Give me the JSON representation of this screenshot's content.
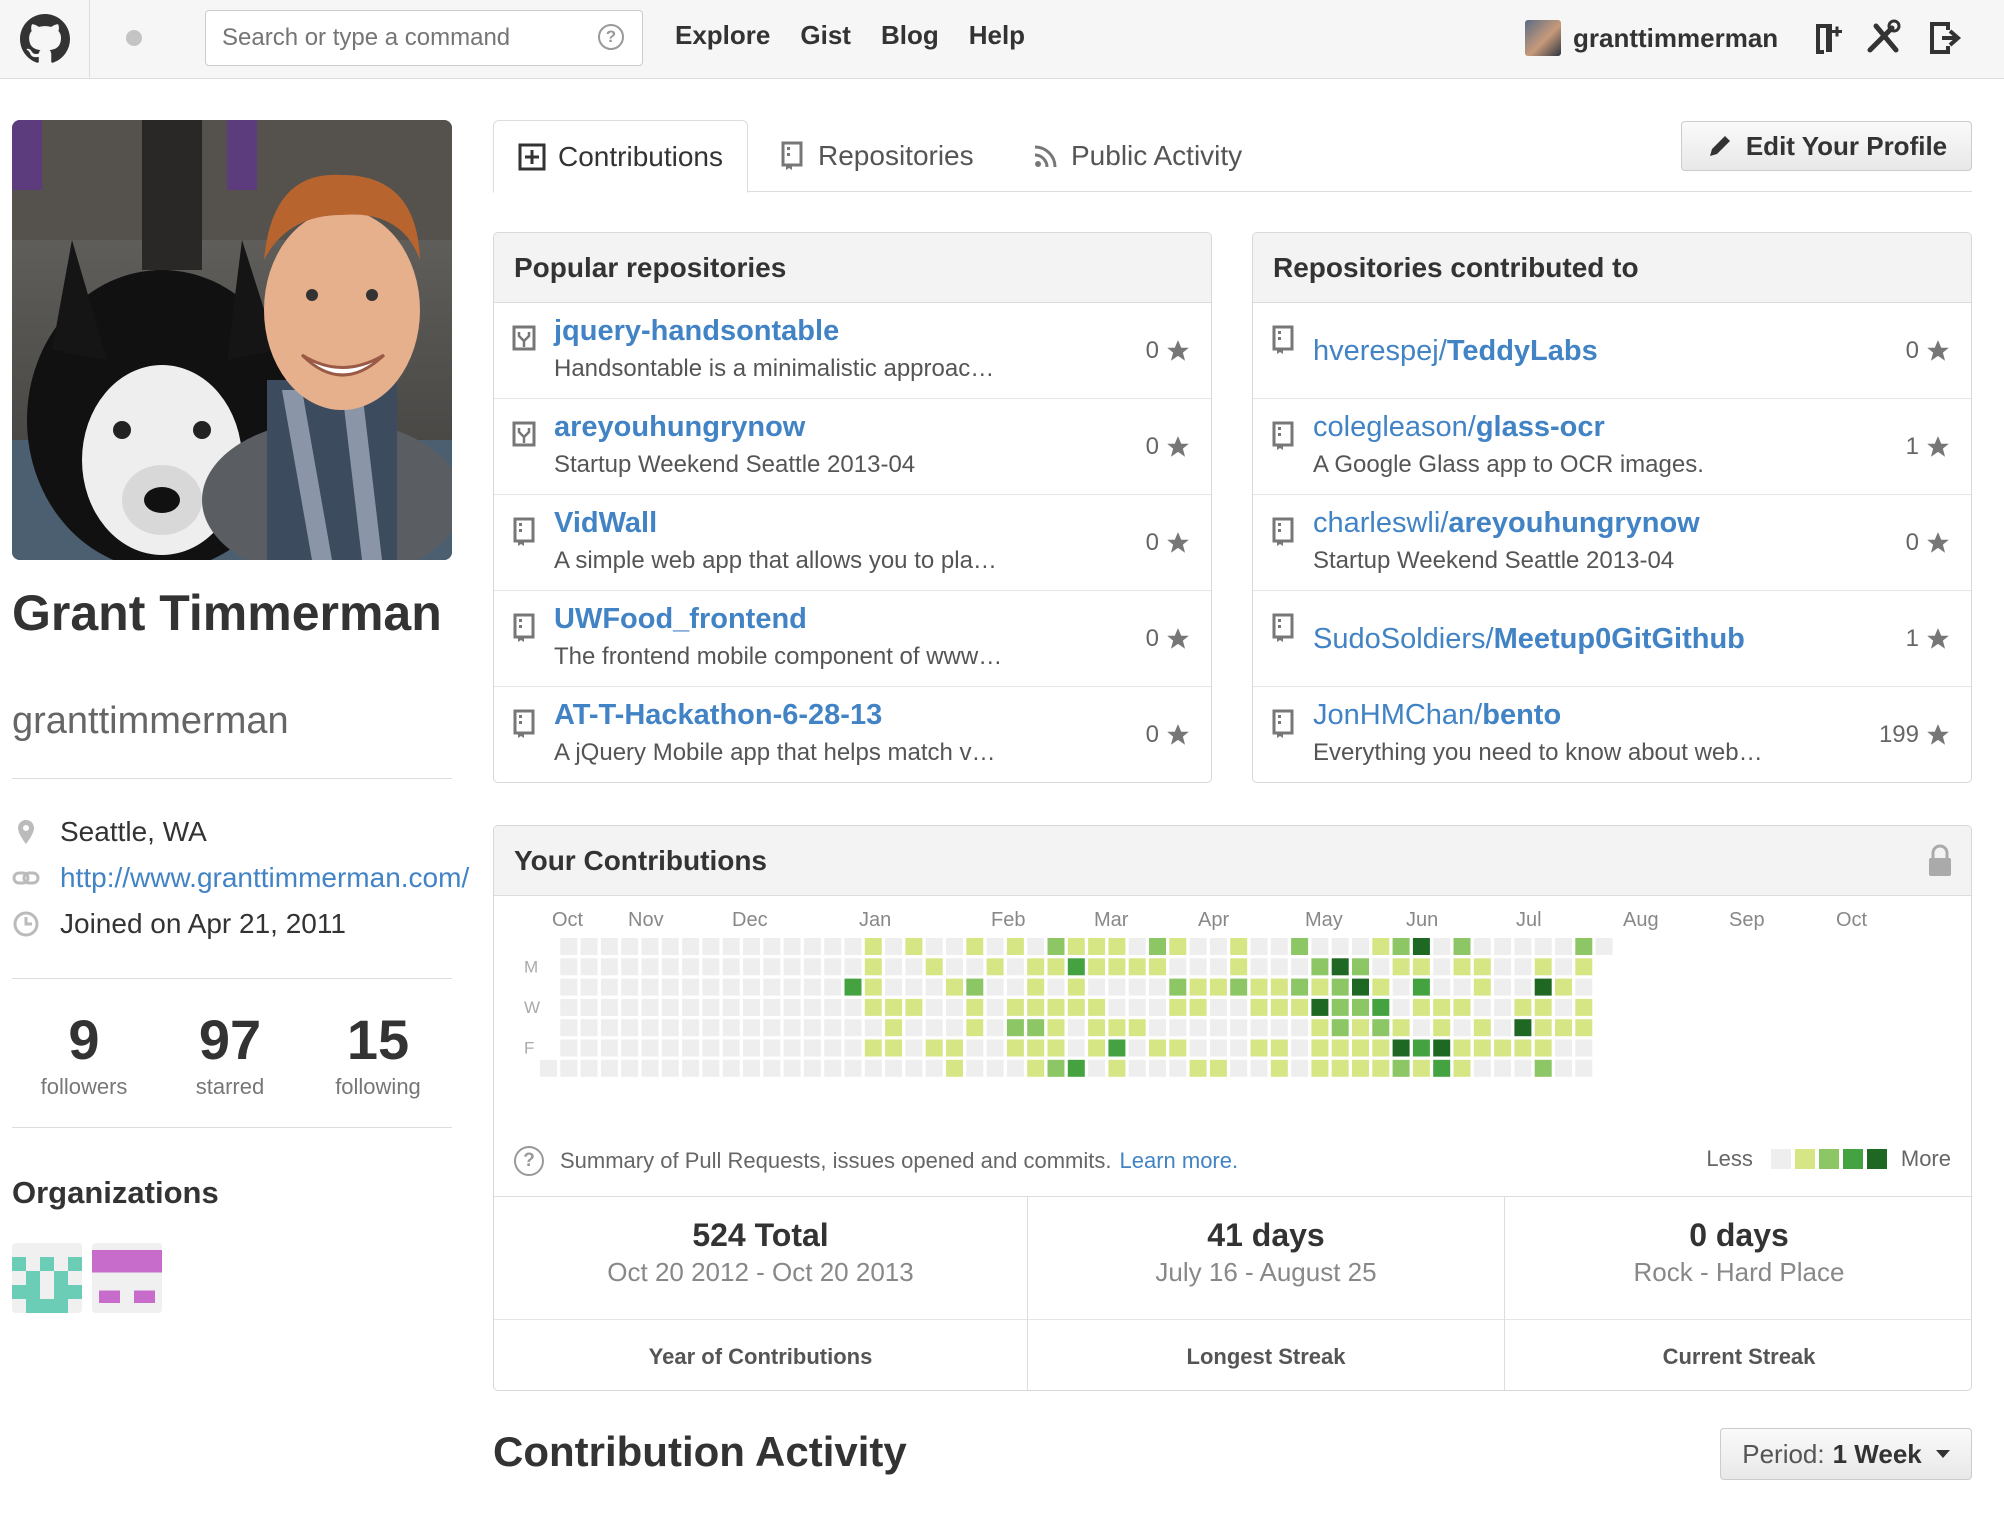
{
  "header": {
    "search_placeholder": "Search or type a command",
    "search_help": "?",
    "nav": [
      "Explore",
      "Gist",
      "Blog",
      "Help"
    ],
    "username": "granttimmerman",
    "icons": [
      "github-octocat-icon",
      "notifications-dot-icon",
      "new-repo-icon",
      "account-settings-icon",
      "sign-out-icon"
    ]
  },
  "profile": {
    "full_name": "Grant Timmerman",
    "username": "granttimmerman",
    "location": "Seattle, WA",
    "website": "http://www.granttimmerman.com/",
    "joined": "Joined on Apr 21, 2011",
    "stats": [
      {
        "value": "9",
        "label": "followers"
      },
      {
        "value": "97",
        "label": "starred"
      },
      {
        "value": "15",
        "label": "following"
      }
    ],
    "organizations_title": "Organizations"
  },
  "tabs": {
    "contributions": "Contributions",
    "repositories": "Repositories",
    "public_activity": "Public Activity",
    "edit_profile": "Edit Your Profile"
  },
  "popular": {
    "title": "Popular repositories",
    "items": [
      {
        "name": "jquery-handsontable",
        "desc": "Handsontable is a minimalistic approac…",
        "stars": "0",
        "fork": true
      },
      {
        "name": "areyouhungrynow",
        "desc": "Startup Weekend Seattle 2013-04",
        "stars": "0",
        "fork": true
      },
      {
        "name": "VidWall",
        "desc": "A simple web app that allows you to pla…",
        "stars": "0",
        "fork": false
      },
      {
        "name": "UWFood_frontend",
        "desc": "The frontend mobile component of www…",
        "stars": "0",
        "fork": false
      },
      {
        "name": "AT-T-Hackathon-6-28-13",
        "desc": "A jQuery Mobile app that helps match v…",
        "stars": "0",
        "fork": false
      }
    ]
  },
  "contributed": {
    "title": "Repositories contributed to",
    "items": [
      {
        "owner": "hverespej/",
        "name": "TeddyLabs",
        "desc": "",
        "stars": "0"
      },
      {
        "owner": "colegleason/",
        "name": "glass-ocr",
        "desc": "A Google Glass app to OCR images.",
        "stars": "1"
      },
      {
        "owner": "charleswli/",
        "name": "areyouhungrynow",
        "desc": "Startup Weekend Seattle 2013-04",
        "stars": "0"
      },
      {
        "owner": "SudoSoldiers/",
        "name": "Meetup0GitGithub",
        "desc": "",
        "stars": "1"
      },
      {
        "owner": "JonHMChan/",
        "name": "bento",
        "desc": "Everything you need to know about web…",
        "stars": "199"
      }
    ]
  },
  "contributions": {
    "title": "Your Contributions",
    "months": [
      "Oct",
      "Nov",
      "Dec",
      "Jan",
      "Feb",
      "Mar",
      "Apr",
      "May",
      "Jun",
      "Jul",
      "Aug",
      "Sep",
      "Oct"
    ],
    "days": [
      "M",
      "W",
      "F"
    ],
    "summary_text": "Summary of Pull Requests, issues opened and commits.",
    "learn_more": "Learn more.",
    "legend_less": "Less",
    "legend_more": "More",
    "colors": [
      "#eeeeee",
      "#d6e685",
      "#8cc665",
      "#44a340",
      "#1e6823"
    ],
    "year_total": "524 Total",
    "year_range": "Oct 20 2012 - Oct 20 2013",
    "year_label": "Year of Contributions",
    "longest": "41 days",
    "longest_range": "July 16 - August 25",
    "longest_label": "Longest Streak",
    "current": "0 days",
    "current_range": "Rock - Hard Place",
    "current_label": "Current Streak"
  },
  "activity": {
    "title": "Contribution Activity",
    "period_label": "Period:",
    "period_value": "1 Week"
  }
}
